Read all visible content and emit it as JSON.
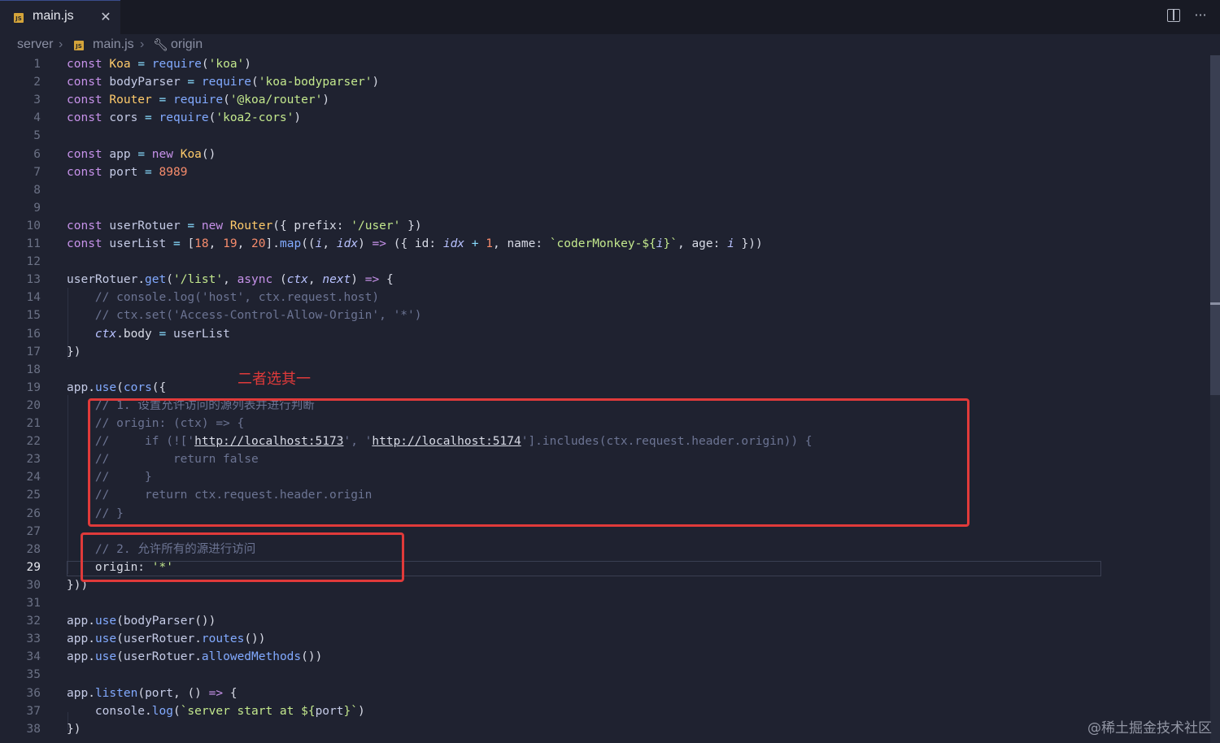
{
  "tab": {
    "label": "main.js",
    "icon": "JS",
    "close": "✕"
  },
  "toolbar": {
    "split": "",
    "more": "···"
  },
  "breadcrumb": {
    "folder": "server",
    "file": "main.js",
    "symbol": "origin",
    "sep": "›"
  },
  "annotation": "二者选其一",
  "watermark": "@稀土掘金技术社区",
  "editor": {
    "active_line": 29,
    "lines": [
      {
        "n": "1",
        "t": [
          [
            "kw",
            "const "
          ],
          [
            "cls",
            "Koa"
          ],
          [
            "op",
            " = "
          ],
          [
            "fn",
            "require"
          ],
          [
            "prop",
            "("
          ],
          [
            "str",
            "'koa'"
          ],
          [
            "prop",
            ")"
          ]
        ]
      },
      {
        "n": "2",
        "t": [
          [
            "kw",
            "const "
          ],
          [
            "var",
            "bodyParser"
          ],
          [
            "op",
            " = "
          ],
          [
            "fn",
            "require"
          ],
          [
            "prop",
            "("
          ],
          [
            "str",
            "'koa-bodyparser'"
          ],
          [
            "prop",
            ")"
          ]
        ]
      },
      {
        "n": "3",
        "t": [
          [
            "kw",
            "const "
          ],
          [
            "cls",
            "Router"
          ],
          [
            "op",
            " = "
          ],
          [
            "fn",
            "require"
          ],
          [
            "prop",
            "("
          ],
          [
            "str",
            "'@koa/router'"
          ],
          [
            "prop",
            ")"
          ]
        ]
      },
      {
        "n": "4",
        "t": [
          [
            "kw",
            "const "
          ],
          [
            "var",
            "cors"
          ],
          [
            "op",
            " = "
          ],
          [
            "fn",
            "require"
          ],
          [
            "prop",
            "("
          ],
          [
            "str",
            "'koa2-cors'"
          ],
          [
            "prop",
            ")"
          ]
        ]
      },
      {
        "n": "5",
        "t": []
      },
      {
        "n": "6",
        "t": [
          [
            "kw",
            "const "
          ],
          [
            "var",
            "app"
          ],
          [
            "op",
            " = "
          ],
          [
            "kw",
            "new "
          ],
          [
            "cls",
            "Koa"
          ],
          [
            "prop",
            "()"
          ]
        ]
      },
      {
        "n": "7",
        "t": [
          [
            "kw",
            "const "
          ],
          [
            "var",
            "port"
          ],
          [
            "op",
            " = "
          ],
          [
            "num",
            "8989"
          ]
        ]
      },
      {
        "n": "8",
        "t": []
      },
      {
        "n": "9",
        "t": []
      },
      {
        "n": "10",
        "t": [
          [
            "kw",
            "const "
          ],
          [
            "var",
            "userRotuer"
          ],
          [
            "op",
            " = "
          ],
          [
            "kw",
            "new "
          ],
          [
            "cls",
            "Router"
          ],
          [
            "prop",
            "({ prefix: "
          ],
          [
            "str",
            "'/user'"
          ],
          [
            "prop",
            " })"
          ]
        ]
      },
      {
        "n": "11",
        "t": [
          [
            "kw",
            "const "
          ],
          [
            "var",
            "userList"
          ],
          [
            "op",
            " = "
          ],
          [
            "prop",
            "["
          ],
          [
            "num",
            "18"
          ],
          [
            "prop",
            ", "
          ],
          [
            "num",
            "19"
          ],
          [
            "prop",
            ", "
          ],
          [
            "num",
            "20"
          ],
          [
            "prop",
            "]."
          ],
          [
            "fn",
            "map"
          ],
          [
            "prop",
            "(("
          ],
          [
            "prm",
            "i"
          ],
          [
            "prop",
            ", "
          ],
          [
            "prm",
            "idx"
          ],
          [
            "prop",
            ") "
          ],
          [
            "kw",
            "=>"
          ],
          [
            "prop",
            " ({ id: "
          ],
          [
            "prm",
            "idx"
          ],
          [
            "op",
            " + "
          ],
          [
            "num",
            "1"
          ],
          [
            "prop",
            ", name: "
          ],
          [
            "str",
            "`coderMonkey-${"
          ],
          [
            "prm",
            "i"
          ],
          [
            "str",
            "}`"
          ],
          [
            "prop",
            ", age: "
          ],
          [
            "prm",
            "i"
          ],
          [
            "prop",
            " }))"
          ]
        ]
      },
      {
        "n": "12",
        "t": []
      },
      {
        "n": "13",
        "t": [
          [
            "var",
            "userRotuer"
          ],
          [
            "prop",
            "."
          ],
          [
            "fn",
            "get"
          ],
          [
            "prop",
            "("
          ],
          [
            "str",
            "'/list'"
          ],
          [
            "prop",
            ", "
          ],
          [
            "kw",
            "async "
          ],
          [
            "prop",
            "("
          ],
          [
            "prm",
            "ctx"
          ],
          [
            "prop",
            ", "
          ],
          [
            "prm",
            "next"
          ],
          [
            "prop",
            ") "
          ],
          [
            "kw",
            "=>"
          ],
          [
            "prop",
            " {"
          ]
        ]
      },
      {
        "n": "14",
        "t": [
          [
            "com",
            "    // console.log('host', ctx.request.host)"
          ]
        ]
      },
      {
        "n": "15",
        "t": [
          [
            "com",
            "    // ctx.set('Access-Control-Allow-Origin', '*')"
          ]
        ]
      },
      {
        "n": "16",
        "t": [
          [
            "prm",
            "    ctx"
          ],
          [
            "prop",
            ".body"
          ],
          [
            "op",
            " = "
          ],
          [
            "var",
            "userList"
          ]
        ]
      },
      {
        "n": "17",
        "t": [
          [
            "prop",
            "})"
          ]
        ]
      },
      {
        "n": "18",
        "t": []
      },
      {
        "n": "19",
        "t": [
          [
            "var",
            "app"
          ],
          [
            "prop",
            "."
          ],
          [
            "fn",
            "use"
          ],
          [
            "prop",
            "("
          ],
          [
            "fn",
            "cors"
          ],
          [
            "prop",
            "({"
          ]
        ]
      },
      {
        "n": "20",
        "t": [
          [
            "com",
            "    // 1. 设置允许访问的源列表并进行判断"
          ]
        ]
      },
      {
        "n": "21",
        "t": [
          [
            "com",
            "    // origin: (ctx) => {"
          ]
        ]
      },
      {
        "n": "22",
        "t": [
          [
            "com",
            "    //     if (!['"
          ],
          [
            "url",
            "http://localhost:5173"
          ],
          [
            "com",
            "', '"
          ],
          [
            "url",
            "http://localhost:5174"
          ],
          [
            "com",
            "'].includes(ctx.request.header.origin)) {"
          ]
        ]
      },
      {
        "n": "23",
        "t": [
          [
            "com",
            "    //         return false"
          ]
        ]
      },
      {
        "n": "24",
        "t": [
          [
            "com",
            "    //     }"
          ]
        ]
      },
      {
        "n": "25",
        "t": [
          [
            "com",
            "    //     return ctx.request.header.origin"
          ]
        ]
      },
      {
        "n": "26",
        "t": [
          [
            "com",
            "    // }"
          ]
        ]
      },
      {
        "n": "27",
        "t": []
      },
      {
        "n": "28",
        "t": [
          [
            "com",
            "    // 2. 允许所有的源进行访问"
          ]
        ]
      },
      {
        "n": "29",
        "t": [
          [
            "prop",
            "    origin: "
          ],
          [
            "str",
            "'*'"
          ]
        ]
      },
      {
        "n": "30",
        "t": [
          [
            "prop",
            "}))"
          ]
        ]
      },
      {
        "n": "31",
        "t": []
      },
      {
        "n": "32",
        "t": [
          [
            "var",
            "app"
          ],
          [
            "prop",
            "."
          ],
          [
            "fn",
            "use"
          ],
          [
            "prop",
            "("
          ],
          [
            "var",
            "bodyParser"
          ],
          [
            "prop",
            "())"
          ]
        ]
      },
      {
        "n": "33",
        "t": [
          [
            "var",
            "app"
          ],
          [
            "prop",
            "."
          ],
          [
            "fn",
            "use"
          ],
          [
            "prop",
            "("
          ],
          [
            "var",
            "userRotuer"
          ],
          [
            "prop",
            "."
          ],
          [
            "fn",
            "routes"
          ],
          [
            "prop",
            "())"
          ]
        ]
      },
      {
        "n": "34",
        "t": [
          [
            "var",
            "app"
          ],
          [
            "prop",
            "."
          ],
          [
            "fn",
            "use"
          ],
          [
            "prop",
            "("
          ],
          [
            "var",
            "userRotuer"
          ],
          [
            "prop",
            "."
          ],
          [
            "fn",
            "allowedMethods"
          ],
          [
            "prop",
            "())"
          ]
        ]
      },
      {
        "n": "35",
        "t": []
      },
      {
        "n": "36",
        "t": [
          [
            "var",
            "app"
          ],
          [
            "prop",
            "."
          ],
          [
            "fn",
            "listen"
          ],
          [
            "prop",
            "("
          ],
          [
            "var",
            "port"
          ],
          [
            "prop",
            ", () "
          ],
          [
            "kw",
            "=>"
          ],
          [
            "prop",
            " {"
          ]
        ]
      },
      {
        "n": "37",
        "t": [
          [
            "var",
            "    console"
          ],
          [
            "prop",
            "."
          ],
          [
            "fn",
            "log"
          ],
          [
            "prop",
            "("
          ],
          [
            "str",
            "`server start at ${"
          ],
          [
            "var",
            "port"
          ],
          [
            "str",
            "}`"
          ],
          [
            "prop",
            ")"
          ]
        ]
      },
      {
        "n": "38",
        "t": [
          [
            "prop",
            "})"
          ]
        ]
      }
    ]
  }
}
